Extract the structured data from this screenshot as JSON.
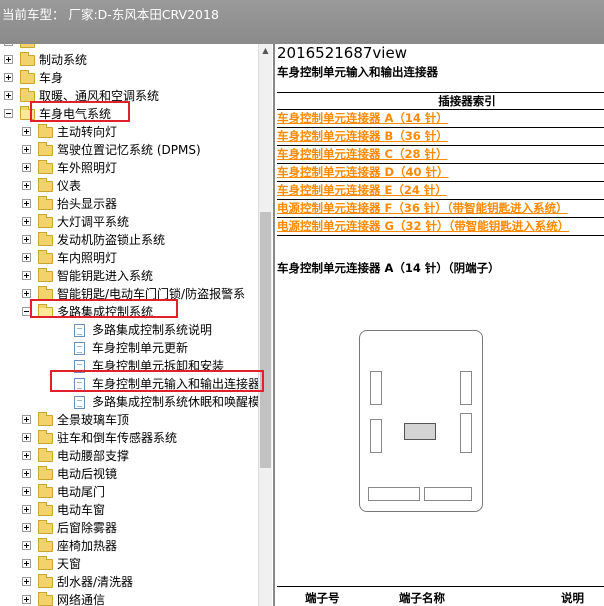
{
  "header": {
    "vehicle_info": "当前车型：  厂家:D-东风本田CRV2018"
  },
  "tree": [
    {
      "label": "",
      "depth": 0,
      "expander": "plus",
      "icon": "folder"
    },
    {
      "label": "制动系统",
      "depth": 0,
      "expander": "plus",
      "icon": "folder"
    },
    {
      "label": "车身",
      "depth": 0,
      "expander": "plus",
      "icon": "folder"
    },
    {
      "label": "取暖、通风和空调系统",
      "depth": 0,
      "expander": "plus",
      "icon": "folder"
    },
    {
      "label": "车身电气系统",
      "depth": 0,
      "expander": "minus",
      "icon": "folder-open"
    },
    {
      "label": "主动转向灯",
      "depth": 1,
      "expander": "plus",
      "icon": "folder"
    },
    {
      "label": "驾驶位置记忆系统 (DPMS)",
      "depth": 1,
      "expander": "plus",
      "icon": "folder"
    },
    {
      "label": "车外照明灯",
      "depth": 1,
      "expander": "plus",
      "icon": "folder"
    },
    {
      "label": "仪表",
      "depth": 1,
      "expander": "plus",
      "icon": "folder"
    },
    {
      "label": "抬头显示器",
      "depth": 1,
      "expander": "plus",
      "icon": "folder"
    },
    {
      "label": "大灯调平系统",
      "depth": 1,
      "expander": "plus",
      "icon": "folder"
    },
    {
      "label": "发动机防盗锁止系统",
      "depth": 1,
      "expander": "plus",
      "icon": "folder"
    },
    {
      "label": "车内照明灯",
      "depth": 1,
      "expander": "plus",
      "icon": "folder"
    },
    {
      "label": "智能钥匙进入系统",
      "depth": 1,
      "expander": "plus",
      "icon": "folder"
    },
    {
      "label": "智能钥匙/电动车门门锁/防盗报警系",
      "depth": 1,
      "expander": "plus",
      "icon": "folder"
    },
    {
      "label": "多路集成控制系统",
      "depth": 1,
      "expander": "minus",
      "icon": "folder-open"
    },
    {
      "label": "多路集成控制系统说明",
      "depth": 2,
      "expander": "none",
      "icon": "doc"
    },
    {
      "label": "车身控制单元更新",
      "depth": 2,
      "expander": "none",
      "icon": "doc"
    },
    {
      "label": "车身控制单元拆卸和安装",
      "depth": 2,
      "expander": "none",
      "icon": "doc"
    },
    {
      "label": "车身控制单元输入和输出连接器",
      "depth": 2,
      "expander": "none",
      "icon": "doc"
    },
    {
      "label": "多路集成控制系统休眠和唤醒模",
      "depth": 2,
      "expander": "none",
      "icon": "doc"
    },
    {
      "label": "全景玻璃车顶",
      "depth": 1,
      "expander": "plus",
      "icon": "folder"
    },
    {
      "label": "驻车和倒车传感器系统",
      "depth": 1,
      "expander": "plus",
      "icon": "folder"
    },
    {
      "label": "电动腰部支撑",
      "depth": 1,
      "expander": "plus",
      "icon": "folder"
    },
    {
      "label": "电动后视镜",
      "depth": 1,
      "expander": "plus",
      "icon": "folder"
    },
    {
      "label": "电动尾门",
      "depth": 1,
      "expander": "plus",
      "icon": "folder"
    },
    {
      "label": "电动车窗",
      "depth": 1,
      "expander": "plus",
      "icon": "folder"
    },
    {
      "label": "后窗除雾器",
      "depth": 1,
      "expander": "plus",
      "icon": "folder"
    },
    {
      "label": "座椅加热器",
      "depth": 1,
      "expander": "plus",
      "icon": "folder"
    },
    {
      "label": "天窗",
      "depth": 1,
      "expander": "plus",
      "icon": "folder"
    },
    {
      "label": "刮水器/清洗器",
      "depth": 1,
      "expander": "plus",
      "icon": "folder"
    },
    {
      "label": "网络通信",
      "depth": 1,
      "expander": "plus",
      "icon": "folder"
    }
  ],
  "document": {
    "id": "2016521687view",
    "heading": "车身控制单元输入和输出连接器",
    "table_header": "插接器索引",
    "links": [
      "车身控制单元连接器 A（14 针）",
      "车身控制单元连接器 B（36 针）",
      "车身控制单元连接器 C（28 针）",
      "车身控制单元连接器 D（40 针）",
      "车身控制单元连接器 E（24 针）",
      "电源控制单元连接器 F（36 针）（带智能钥匙进入系统）",
      "电源控制单元连接器 G（32 针）（带智能钥匙进入系统）"
    ],
    "section_a_title": "车身控制单元连接器 A（14 针）（阴端子）",
    "pin_table": {
      "col_pin": "端子号",
      "col_name": "端子名称",
      "col_desc": "说明"
    }
  },
  "colors": {
    "link": "#ff8a00",
    "highlight_box": "#e0212b",
    "titlebar": "#8f8f8f"
  }
}
